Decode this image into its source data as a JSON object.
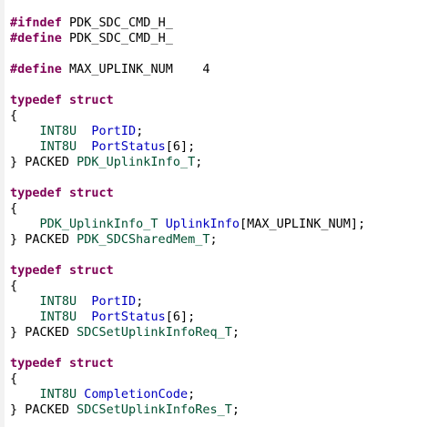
{
  "editor": {
    "lines": [
      {
        "kind": "ifndef",
        "kw": "#ifndef",
        "rest": " PDK_SDC_CMD_H_"
      },
      {
        "kind": "define",
        "kw": "#define",
        "rest": " PDK_SDC_CMD_H_"
      },
      {
        "kind": "blank"
      },
      {
        "kind": "define",
        "kw": "#define",
        "rest": " MAX_UPLINK_NUM    4"
      },
      {
        "kind": "blank"
      },
      {
        "kind": "typedef",
        "kw1": "typedef",
        "kw2": "struct"
      },
      {
        "kind": "brace",
        "text": "{"
      },
      {
        "kind": "member",
        "type": "INT8U",
        "gap": "  ",
        "name": "PortID",
        "suffix": ";"
      },
      {
        "kind": "member",
        "type": "INT8U",
        "gap": "  ",
        "name": "PortStatus",
        "suffix": "[6];"
      },
      {
        "kind": "close",
        "prefix": "} PACKED ",
        "name": "PDK_UplinkInfo_T",
        "suffix": ";"
      },
      {
        "kind": "blank"
      },
      {
        "kind": "typedef",
        "kw1": "typedef",
        "kw2": "struct"
      },
      {
        "kind": "brace",
        "text": "{"
      },
      {
        "kind": "member",
        "type": "PDK_UplinkInfo_T",
        "gap": " ",
        "name": "UplinkInfo",
        "suffix": "[MAX_UPLINK_NUM];"
      },
      {
        "kind": "close",
        "prefix": "} PACKED ",
        "name": "PDK_SDCSharedMem_T",
        "suffix": ";"
      },
      {
        "kind": "blank"
      },
      {
        "kind": "typedef",
        "kw1": "typedef",
        "kw2": "struct"
      },
      {
        "kind": "brace",
        "text": "{"
      },
      {
        "kind": "member",
        "type": "INT8U",
        "gap": "  ",
        "name": "PortID",
        "suffix": ";"
      },
      {
        "kind": "member",
        "type": "INT8U",
        "gap": "  ",
        "name": "PortStatus",
        "suffix": "[6];"
      },
      {
        "kind": "close",
        "prefix": "} PACKED ",
        "name": "SDCSetUplinkInfoReq_T",
        "suffix": ";"
      },
      {
        "kind": "blank"
      },
      {
        "kind": "typedef",
        "kw1": "typedef",
        "kw2": "struct"
      },
      {
        "kind": "brace",
        "text": "{"
      },
      {
        "kind": "member",
        "type": "INT8U",
        "gap": " ",
        "name": "CompletionCode",
        "suffix": ";"
      },
      {
        "kind": "close",
        "prefix": "} PACKED ",
        "name": "SDCSetUplinkInfoRes_T",
        "suffix": ";"
      }
    ]
  }
}
